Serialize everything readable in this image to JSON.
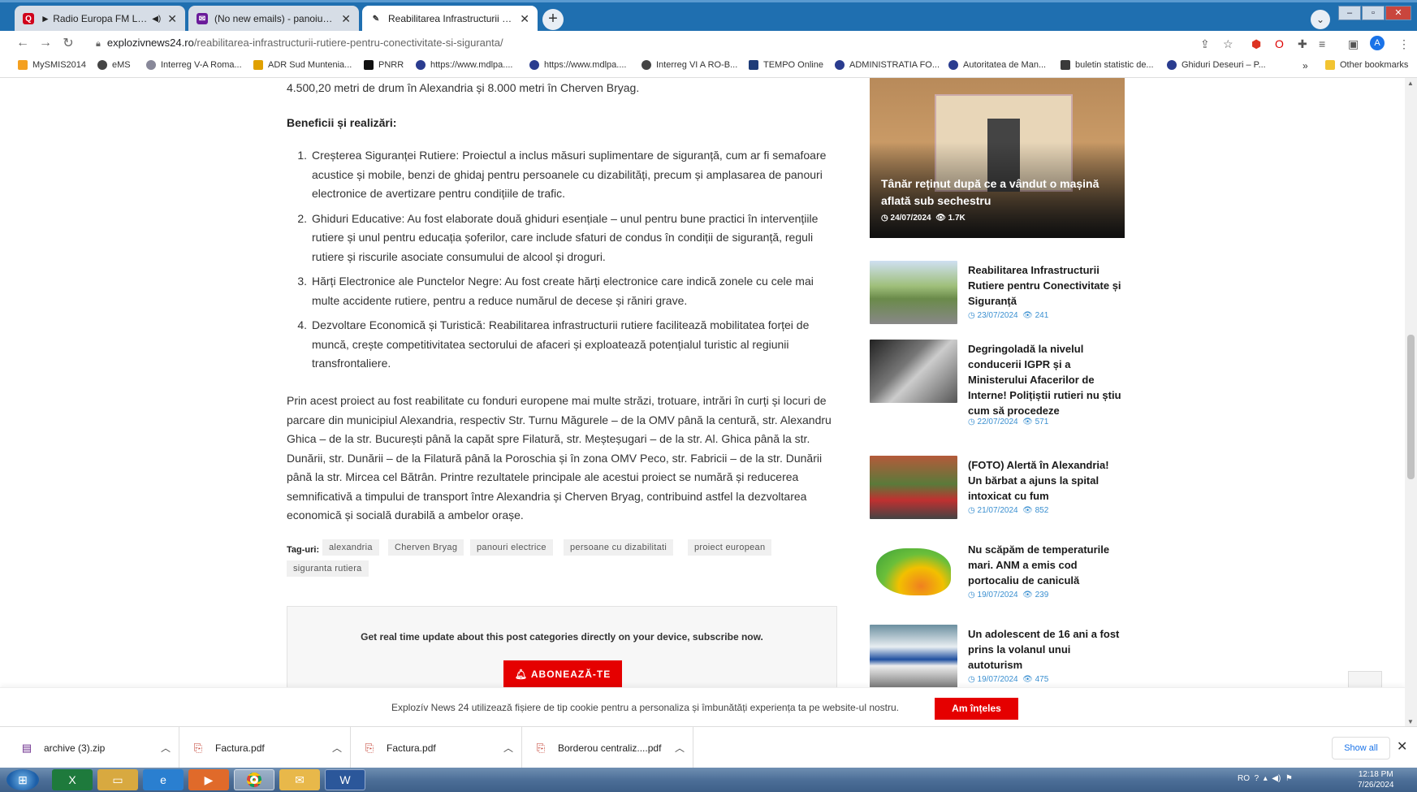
{
  "browser": {
    "tabs": [
      {
        "title": "► Radio Europa FM LIVE – A",
        "favicon_color": "#d0021b",
        "active": false
      },
      {
        "title": "(No new emails) - panoiucarmen",
        "favicon_color": "#6a1b9a",
        "active": false
      },
      {
        "title": "Reabilitarea Infrastructurii Rutier",
        "favicon_color": "#555555",
        "active": true
      }
    ],
    "new_tab": "+",
    "url_domain": "explozivnews24.ro",
    "url_path": "/reabilitarea-infrastructurii-rutiere-pentru-conectivitate-si-siguranta/",
    "bookmarks": [
      "MySMIS2014",
      "eMS",
      "Interreg V-A Roma...",
      "ADR Sud Muntenia...",
      "PNRR",
      "https://www.mdlpa....",
      "https://www.mdlpa....",
      "Interreg VI A RO-B...",
      "TEMPO Online",
      "ADMINISTRATIA FO...",
      "Autoritatea de Man...",
      "buletin statistic de...",
      "Ghiduri Deseuri – P..."
    ],
    "bookmarks_more": "»",
    "other_bookmarks": "Other bookmarks"
  },
  "article": {
    "intro": "4.500,20 metri de drum în Alexandria și 8.000 metri în Cherven Bryag.",
    "benefits_heading": "Beneficii și realizări:",
    "list": [
      {
        "num": "1.",
        "text": "Creșterea Siguranței Rutiere: Proiectul a inclus măsuri suplimentare de siguranță, cum ar fi semafoare acustice și mobile, benzi de ghidaj pentru persoanele cu dizabilități, precum și amplasarea de panouri electronice de avertizare pentru condițiile de trafic."
      },
      {
        "num": "2.",
        "text": "Ghiduri Educative: Au fost elaborate două ghiduri esențiale – unul pentru bune practici în intervențiile rutiere și unul pentru educația șoferilor, care include sfaturi de condus în condiții de siguranță, reguli rutiere și riscurile asociate consumului de alcool și droguri."
      },
      {
        "num": "3.",
        "text": "Hărți Electronice ale Punctelor Negre: Au fost create hărți electronice care indică zonele cu cele mai multe accidente rutiere, pentru a reduce numărul de decese și răniri grave."
      },
      {
        "num": "4.",
        "text": "Dezvoltare Economică și Turistică: Reabilitarea infrastructurii rutiere facilitează mobilitatea forței de muncă, crește competitivitatea sectorului de afaceri și exploatează potențialul turistic al regiunii transfrontaliere."
      }
    ],
    "paragraph": "Prin acest proiect au fost reabilitate cu fonduri europene mai multe străzi, trotuare, intrări în curți și locuri de parcare din municipiul Alexandria, respectiv Str. Turnu Măgurele – de la OMV până la centură, str. Alexandru Ghica – de la str. București până la capăt spre Filatură, str. Meșteșugari – de la str. Al. Ghica până la str. Dunării, str. Dunării – de la Filatură până la Poroschia și în zona OMV Peco, str. Fabricii – de la str. Dunării până la str. Mircea cel Bătrân. Printre rezultatele principale ale acestui proiect se numără și reducerea semnificativă a timpului de transport între Alexandria și Cherven Bryag, contribuind astfel la dezvoltarea economică și socială durabilă a ambelor orașe.",
    "tags_label": "Tag-uri:",
    "tags": [
      "alexandria",
      "Cherven Bryag",
      "panouri electrice",
      "persoane cu dizabilitati",
      "proiect european",
      "siguranta rutiera"
    ]
  },
  "subscribe": {
    "text": "Get real time update about this post categories directly on your device, subscribe now.",
    "button": "ABONEAZĂ-TE",
    "button_icon": "bell-icon"
  },
  "sidebar": {
    "featured": {
      "title": "Tânăr reținut după ce a vândut o mașină aflată sub sechestru",
      "date": "24/07/2024",
      "views": "1.7K"
    },
    "items": [
      {
        "title": "Reabilitarea Infrastructurii Rutiere pentru Conectivitate și Siguranță",
        "date": "23/07/2024",
        "views": "241"
      },
      {
        "title": "Degringoladă la nivelul conducerii IGPR și a Ministerului Afacerilor de Interne! Polițiștii rutieri nu știu cum să procedeze",
        "date": "22/07/2024",
        "views": "571"
      },
      {
        "title": "(FOTO) Alertă în Alexandria! Un bărbat a ajuns la spital intoxicat cu fum",
        "date": "21/07/2024",
        "views": "852"
      },
      {
        "title": "Nu scăpăm de temperaturile mari. ANM a emis cod portocaliu de caniculă",
        "date": "19/07/2024",
        "views": "239"
      },
      {
        "title": "Un adolescent de 16 ani a fost prins la volanul unui autoturism",
        "date": "19/07/2024",
        "views": "475"
      }
    ]
  },
  "cookie": {
    "text": "Explozív News 24 utilizează fișiere de tip cookie pentru a personaliza și îmbunătăți experiența ta pe website-ul nostru.",
    "button": "Am înțeles"
  },
  "downloads": {
    "items": [
      "archive (3).zip",
      "Factura.pdf",
      "Factura.pdf",
      "Borderou centraliz....pdf"
    ],
    "show_all": "Show all"
  },
  "taskbar": {
    "lang": "RO",
    "time": "12:18 PM",
    "date": "7/26/2024"
  },
  "colors": {
    "accent_red": "#e50000",
    "meta_blue": "#3a8fd0",
    "tabbar": "#1f6fb0"
  }
}
